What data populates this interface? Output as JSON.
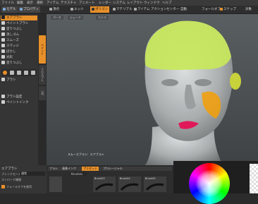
{
  "menu": [
    "ファイル",
    "編集",
    "表示",
    "選択",
    "アイテム",
    "テクスチャ",
    "アニメート",
    "レンダー",
    "システム",
    "レイアウト",
    "ウィンドウ",
    "ヘルプ"
  ],
  "toolbar": {
    "mode_tabs": [
      "モデル",
      "プロパティ"
    ],
    "buttons": [
      "頂点",
      "エッジ",
      "ポリゴン",
      "マテリアル",
      "アイテム",
      "アクションセンター",
      "自動",
      "フォールオフ",
      "なし",
      "スナップ",
      "対象"
    ],
    "active_button": "ポリゴン"
  },
  "left_panel": {
    "tools": [
      "エアブラシ",
      "ペイントブラシ",
      "塗りつぶし",
      "消しゴム",
      "スムーズ",
      "スマッジ",
      "ぼかし",
      "光彩",
      "塗りつぶし",
      "ぼかし",
      "ブラシ"
    ],
    "lower": [
      "ブラシ設定",
      "ペイントインク"
    ],
    "active_tool": "エアブラシ"
  },
  "vertical_tabs": [
    "ペイント",
    "スカルプト",
    "UV"
  ],
  "viewport": {
    "tabs": [
      "パース",
      "シェード",
      "カメラ"
    ],
    "status_text": "スムーズブラシ：エアブラシ"
  },
  "bottom": {
    "brush_panel_title": "エアブラシ",
    "brush_panel_rows": [
      "ブレンドモード",
      "通常",
      "ストローク補間",
      "フォールオフを使用"
    ],
    "brushes_tabs": [
      "ブラシ",
      "画像インク",
      "プリセット",
      "プロシージャル"
    ],
    "brush_items": [
      "Brush03",
      "Brush04",
      "Brush05"
    ],
    "filter_label": "Brushes"
  },
  "colors": {
    "accent": "#e8902a",
    "head_skin": "#b9bcbc",
    "paint_green": "#c8e85a",
    "paint_orange": "#f0a010",
    "paint_magenta": "#e0185a"
  }
}
